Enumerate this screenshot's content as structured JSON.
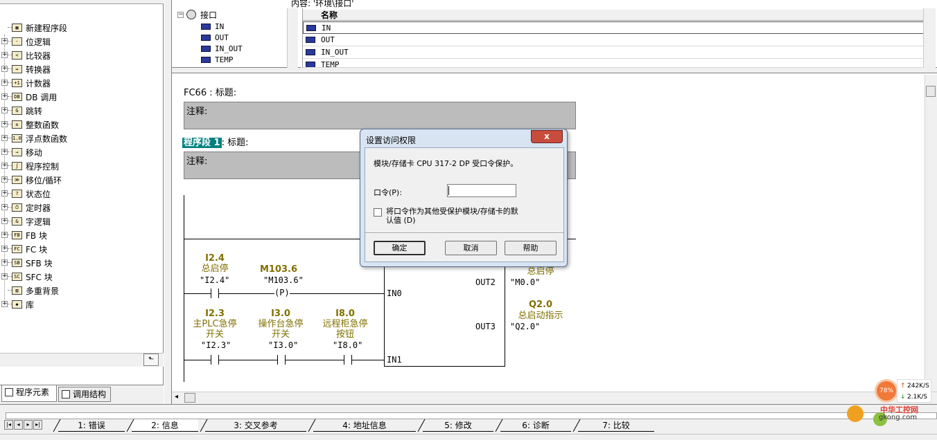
{
  "left_tree": {
    "items": [
      {
        "label": "新建程序段",
        "icon": "new-network-icon",
        "expandable": false
      },
      {
        "label": "位逻辑",
        "icon": "bit-logic-icon",
        "expandable": true
      },
      {
        "label": "比较器",
        "icon": "comparator-icon",
        "expandable": true
      },
      {
        "label": "转换器",
        "icon": "converter-icon",
        "expandable": true
      },
      {
        "label": "计数器",
        "icon": "counter-icon",
        "expandable": true
      },
      {
        "label": "DB 调用",
        "icon": "db-call-icon",
        "expandable": true
      },
      {
        "label": "跳转",
        "icon": "jump-icon",
        "expandable": true
      },
      {
        "label": "整数函数",
        "icon": "integer-function-icon",
        "expandable": true
      },
      {
        "label": "浮点数函数",
        "icon": "float-function-icon",
        "expandable": true
      },
      {
        "label": "移动",
        "icon": "move-icon",
        "expandable": true
      },
      {
        "label": "程序控制",
        "icon": "program-control-icon",
        "expandable": true
      },
      {
        "label": "移位/循环",
        "icon": "shift-rotate-icon",
        "expandable": true
      },
      {
        "label": "状态位",
        "icon": "status-bit-icon",
        "expandable": true
      },
      {
        "label": "定时器",
        "icon": "timer-icon",
        "expandable": true
      },
      {
        "label": "字逻辑",
        "icon": "word-logic-icon",
        "expandable": true
      },
      {
        "label": "FB 块",
        "icon": "fb-block-icon",
        "expandable": true
      },
      {
        "label": "FC 块",
        "icon": "fc-block-icon",
        "expandable": true
      },
      {
        "label": "SFB 块",
        "icon": "sfb-block-icon",
        "expandable": true
      },
      {
        "label": "SFC 块",
        "icon": "sfc-block-icon",
        "expandable": true
      },
      {
        "label": "多重背景",
        "icon": "multi-instance-icon",
        "expandable": false
      },
      {
        "label": "库",
        "icon": "library-icon",
        "expandable": true
      }
    ],
    "tabs": [
      "程序元素",
      "调用结构"
    ]
  },
  "interface": {
    "content_label": "内容: '环境\\接口'",
    "root": "接口",
    "tree_items": [
      "IN",
      "OUT",
      "IN_OUT",
      "TEMP"
    ],
    "table_header": "名称",
    "table_rows": [
      "IN",
      "OUT",
      "IN_OUT",
      "TEMP"
    ]
  },
  "editor": {
    "block_title": "FC66 : 标题:",
    "comment1": "注释:",
    "network_label": "程序段 1",
    "network_title": ": 标题:",
    "comment2": "注释:",
    "ladder": {
      "c1_addr": "I2.4",
      "c1_sym": "总启停",
      "c1_quote": "\"I2.4\"",
      "c2_addr": "M103.6",
      "c2_quote": "\"M103.6\"",
      "c2_coil": "P",
      "c3_addr": "I2.3",
      "c3_sym1": "主PLC急停",
      "c3_sym2": "开关",
      "c3_quote": "\"I2.3\"",
      "c4_addr": "I3.0",
      "c4_sym1": "操作台急停",
      "c4_sym2": "开关",
      "c4_quote": "\"I3.0\"",
      "c5_addr": "I8.0",
      "c5_sym1": "远程柜急停",
      "c5_sym2": "按钮",
      "c5_quote": "\"I8.0\"",
      "pin_in0": "IN0",
      "pin_in1": "IN1",
      "pin_out2": "OUT2",
      "pin_out3": "OUT3",
      "o2_sym": "总启停",
      "o2_quote": "\"M0.0\"",
      "o3_addr": "Q2.0",
      "o3_sym": "总启动指示",
      "o3_quote": "\"Q2.0\""
    }
  },
  "bottom_tabs": [
    "1: 错误",
    "2: 信息",
    "3: 交叉参考",
    "4: 地址信息",
    "5: 修改",
    "6: 诊断",
    "7: 比较"
  ],
  "speed_widget": {
    "percent": "78%",
    "up": "242K/S",
    "down": "2.1K/S"
  },
  "watermark": {
    "text": "中华工控网",
    "url": "gkong.com"
  },
  "dialog": {
    "title": "设置访问权限",
    "close": "x",
    "message": "模块/存储卡 CPU 317-2 DP 受口令保护。",
    "password_label": "口令(P):",
    "password_value": "",
    "checkbox_label": "将口令作为其他受保护模块/存储卡的默认值 (D)",
    "checkbox_checked": false,
    "buttons": {
      "ok": "确定",
      "cancel": "取消",
      "help": "帮助"
    }
  },
  "colors": {
    "symbol_olive": "#807000",
    "network_highlight": "#008080",
    "comment_bg": "#bcbcbc",
    "dialog_close": "#c84c3c"
  }
}
